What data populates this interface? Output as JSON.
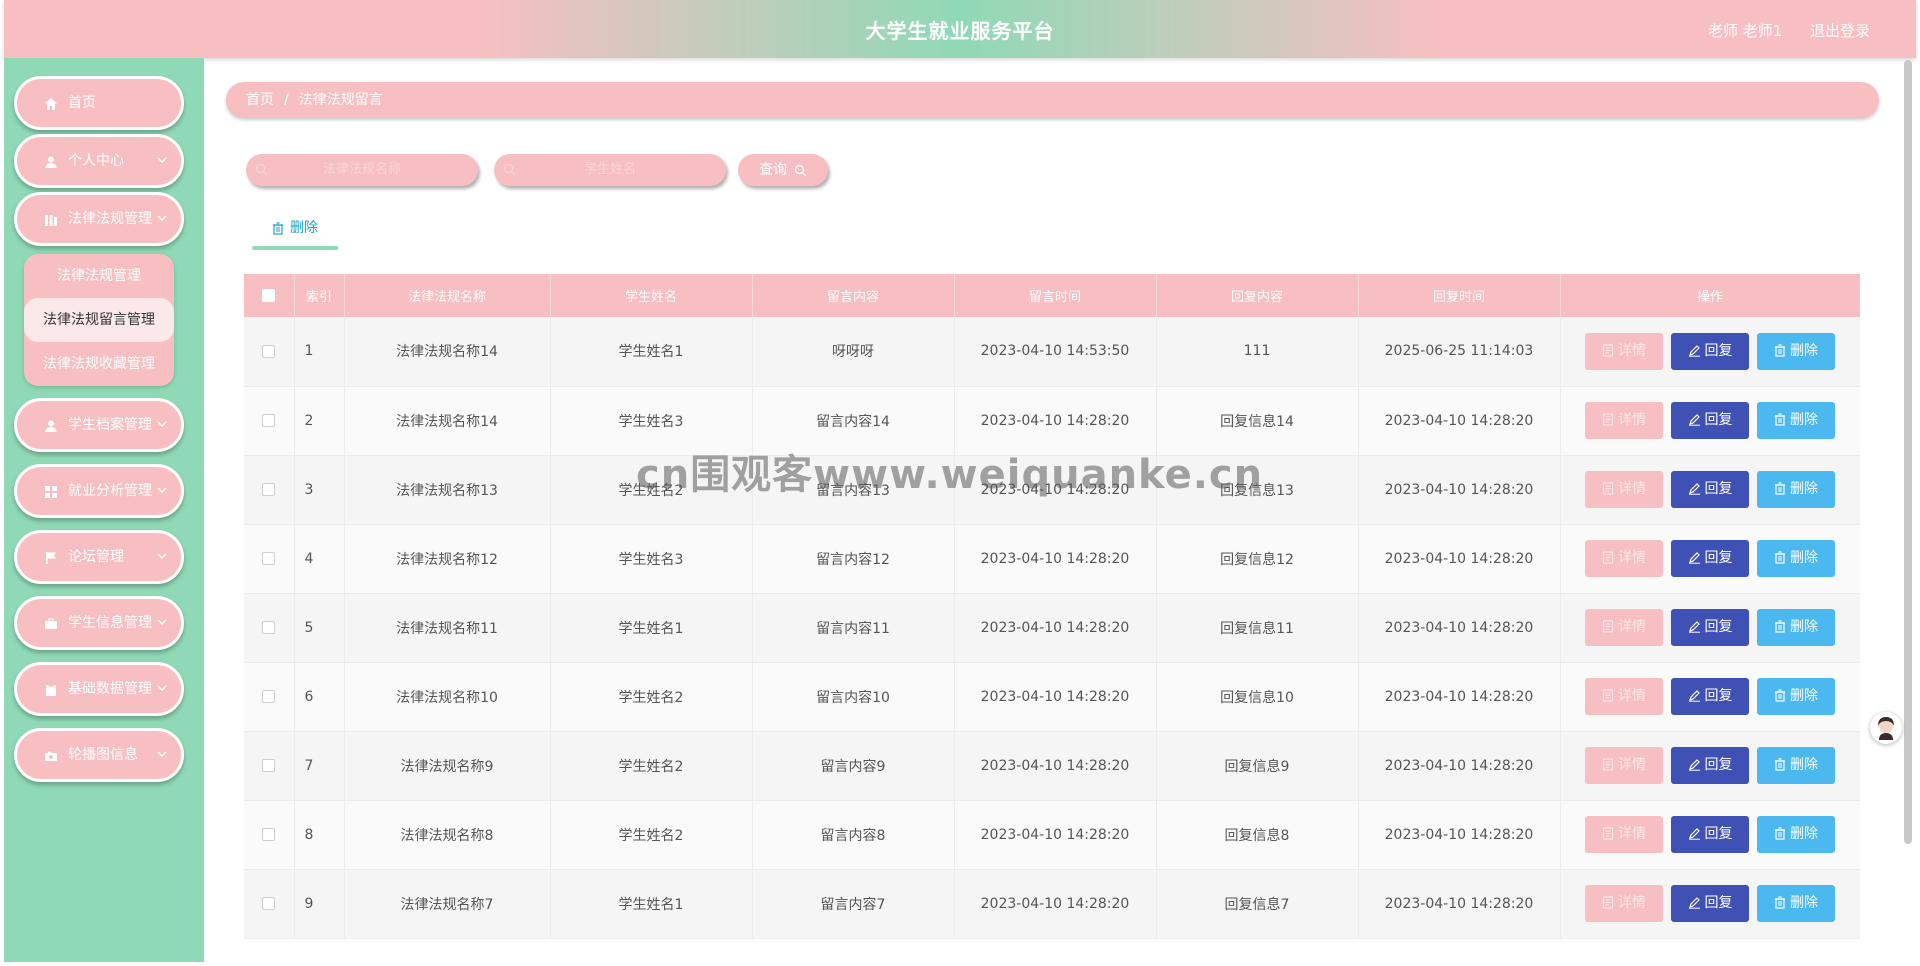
{
  "header": {
    "title": "大学生就业服务平台",
    "user": "老师 老师1",
    "logout": "退出登录"
  },
  "sidebar": {
    "items": [
      {
        "label": "首页",
        "icon": "home-icon"
      },
      {
        "label": "个人中心",
        "icon": "person-icon"
      },
      {
        "label": "法律法规管理",
        "icon": "library-icon"
      },
      {
        "label": "学生档案管理",
        "icon": "person-icon"
      },
      {
        "label": "就业分析管理",
        "icon": "grid-icon"
      },
      {
        "label": "论坛管理",
        "icon": "flag-icon"
      },
      {
        "label": "学生信息管理",
        "icon": "briefcase-icon"
      },
      {
        "label": "基础数据管理",
        "icon": "clipboard-icon"
      },
      {
        "label": "轮播图信息",
        "icon": "camera-icon"
      }
    ],
    "submenu": [
      "法律法规管理",
      "法律法规留言管理",
      "法律法规收藏管理"
    ]
  },
  "breadcrumb": {
    "home": "首页",
    "separator": "/",
    "current": "法律法规留言"
  },
  "search": {
    "name_placeholder": "法律法规名称",
    "student_placeholder": "学生姓名",
    "query_label": "查询"
  },
  "toolbar": {
    "delete_label": "删除"
  },
  "table": {
    "headers": [
      "索引",
      "法律法规名称",
      "学生姓名",
      "留言内容",
      "留言时间",
      "回复内容",
      "回复时间",
      "操作"
    ],
    "actions": {
      "detail": "详情",
      "reply": "回复",
      "delete": "删除"
    },
    "rows": [
      {
        "idx": "1",
        "name": "法律法规名称14",
        "student": "学生姓名1",
        "content": "呀呀呀",
        "time": "2023-04-10 14:53:50",
        "reply": "111",
        "reply_time": "2025-06-25 11:14:03"
      },
      {
        "idx": "2",
        "name": "法律法规名称14",
        "student": "学生姓名3",
        "content": "留言内容14",
        "time": "2023-04-10 14:28:20",
        "reply": "回复信息14",
        "reply_time": "2023-04-10 14:28:20"
      },
      {
        "idx": "3",
        "name": "法律法规名称13",
        "student": "学生姓名2",
        "content": "留言内容13",
        "time": "2023-04-10 14:28:20",
        "reply": "回复信息13",
        "reply_time": "2023-04-10 14:28:20"
      },
      {
        "idx": "4",
        "name": "法律法规名称12",
        "student": "学生姓名3",
        "content": "留言内容12",
        "time": "2023-04-10 14:28:20",
        "reply": "回复信息12",
        "reply_time": "2023-04-10 14:28:20"
      },
      {
        "idx": "5",
        "name": "法律法规名称11",
        "student": "学生姓名1",
        "content": "留言内容11",
        "time": "2023-04-10 14:28:20",
        "reply": "回复信息11",
        "reply_time": "2023-04-10 14:28:20"
      },
      {
        "idx": "6",
        "name": "法律法规名称10",
        "student": "学生姓名2",
        "content": "留言内容10",
        "time": "2023-04-10 14:28:20",
        "reply": "回复信息10",
        "reply_time": "2023-04-10 14:28:20"
      },
      {
        "idx": "7",
        "name": "法律法规名称9",
        "student": "学生姓名2",
        "content": "留言内容9",
        "time": "2023-04-10 14:28:20",
        "reply": "回复信息9",
        "reply_time": "2023-04-10 14:28:20"
      },
      {
        "idx": "8",
        "name": "法律法规名称8",
        "student": "学生姓名2",
        "content": "留言内容8",
        "time": "2023-04-10 14:28:20",
        "reply": "回复信息8",
        "reply_time": "2023-04-10 14:28:20"
      },
      {
        "idx": "9",
        "name": "法律法规名称7",
        "student": "学生姓名1",
        "content": "留言内容7",
        "time": "2023-04-10 14:28:20",
        "reply": "回复信息7",
        "reply_time": "2023-04-10 14:28:20"
      }
    ]
  },
  "watermark": "cn围观客www.weiquanke.cn",
  "colors": {
    "pink": "#f7bfc1",
    "mint": "#8fd9b6",
    "reply": "#3f51b5",
    "delete": "#4cb8f0",
    "tab": "#19a6c8"
  }
}
